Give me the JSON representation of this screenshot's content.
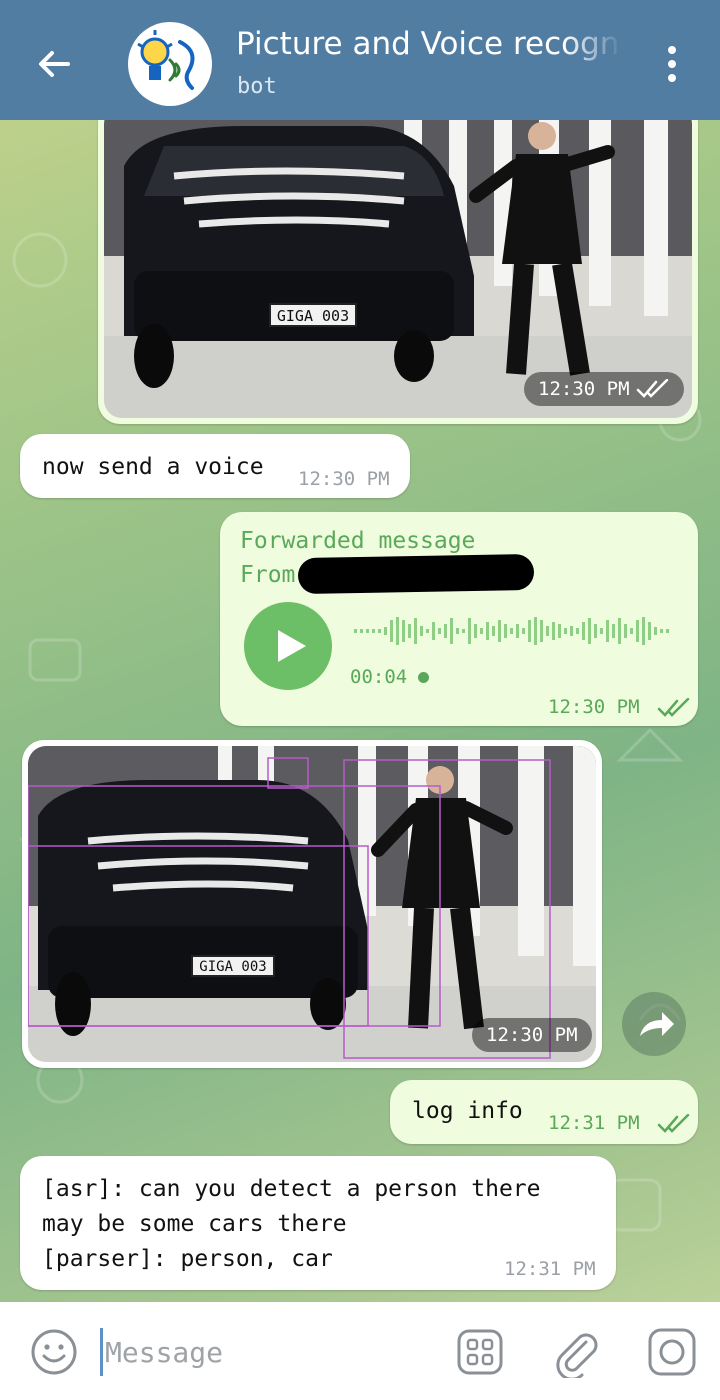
{
  "header": {
    "title": "Picture and Voice recognition",
    "subtitle": "bot",
    "back_icon": "arrow-left-icon",
    "menu_icon": "more-vertical-icon"
  },
  "messages": [
    {
      "type": "photo",
      "direction": "outgoing",
      "time": "12:30 PM",
      "plate": "GIGA 003"
    },
    {
      "type": "text",
      "direction": "incoming",
      "text": "now send a voice",
      "time": "12:30 PM"
    },
    {
      "type": "voice",
      "direction": "outgoing",
      "forwarded_label": "Forwarded message",
      "from_label": "From",
      "duration": "00:04",
      "time": "12:30 PM"
    },
    {
      "type": "photo",
      "direction": "incoming",
      "time": "12:30 PM",
      "plate": "GIGA 003"
    },
    {
      "type": "text",
      "direction": "outgoing",
      "text": "log info",
      "time": "12:31 PM"
    },
    {
      "type": "text",
      "direction": "incoming",
      "lines": [
        "[asr]: can you detect a person there",
        "may be some cars there",
        "[parser]: person, car"
      ],
      "time": "12:31 PM"
    }
  ],
  "composer": {
    "placeholder": "Message",
    "emoji_icon": "emoji-icon",
    "bot_menu_icon": "bot-commands-icon",
    "attach_icon": "paperclip-icon",
    "camera_icon": "camera-icon"
  },
  "colors": {
    "header": "#527da3",
    "outgoing_bubble": "#effdde",
    "incoming_bubble": "#ffffff",
    "accent_green": "#5aa85a",
    "play_button": "#6dbf67"
  }
}
